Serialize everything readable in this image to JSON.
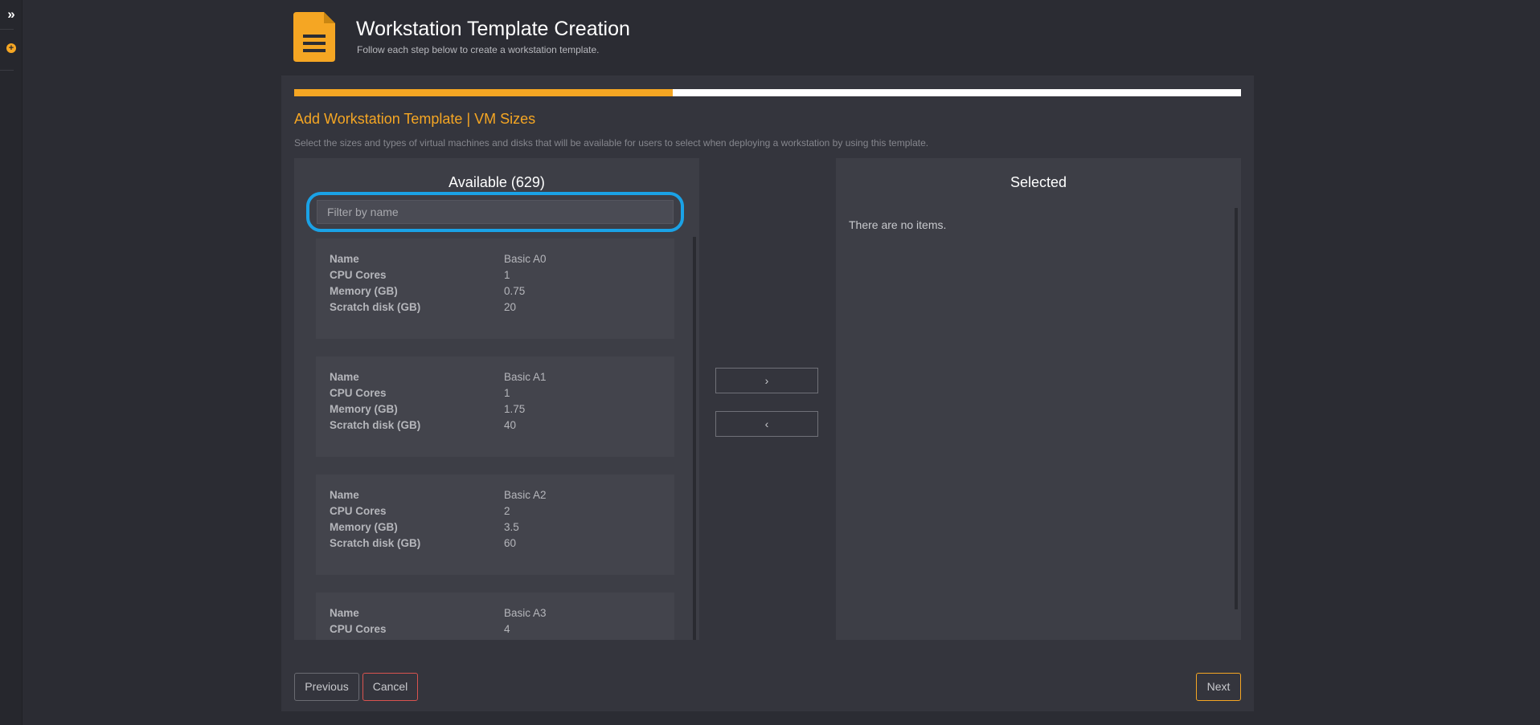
{
  "sidebar": {
    "expand_icon": "chevron-double-right-icon",
    "add_icon": "plus-circle-icon"
  },
  "header": {
    "icon": "document-icon",
    "title": "Workstation Template Creation",
    "subtitle": "Follow each step below to create a workstation template."
  },
  "progress": {
    "percent": 40
  },
  "step": {
    "title": "Add Workstation Template | VM Sizes",
    "description": "Select the sizes and types of virtual machines and disks that will be available for users to select when deploying a workstation by using this template."
  },
  "available": {
    "title": "Available (629)",
    "filter_placeholder": "Filter by name",
    "items": [
      {
        "rows": [
          {
            "key": "Name",
            "value": "Basic A0"
          },
          {
            "key": "CPU Cores",
            "value": "1"
          },
          {
            "key": "Memory (GB)",
            "value": "0.75"
          },
          {
            "key": "Scratch disk (GB)",
            "value": "20"
          }
        ]
      },
      {
        "rows": [
          {
            "key": "Name",
            "value": "Basic A1"
          },
          {
            "key": "CPU Cores",
            "value": "1"
          },
          {
            "key": "Memory (GB)",
            "value": "1.75"
          },
          {
            "key": "Scratch disk (GB)",
            "value": "40"
          }
        ]
      },
      {
        "rows": [
          {
            "key": "Name",
            "value": "Basic A2"
          },
          {
            "key": "CPU Cores",
            "value": "2"
          },
          {
            "key": "Memory (GB)",
            "value": "3.5"
          },
          {
            "key": "Scratch disk (GB)",
            "value": "60"
          }
        ]
      },
      {
        "rows": [
          {
            "key": "Name",
            "value": "Basic A3"
          },
          {
            "key": "CPU Cores",
            "value": "4"
          }
        ]
      }
    ]
  },
  "selected": {
    "title": "Selected",
    "empty_message": "There are no items."
  },
  "transfer": {
    "add_label": "›",
    "remove_label": "‹"
  },
  "footer": {
    "previous_label": "Previous",
    "cancel_label": "Cancel",
    "next_label": "Next"
  },
  "colors": {
    "accent": "#f5a623",
    "highlight": "#1aa2e6",
    "danger": "#d9534f",
    "background": "#2b2c33"
  }
}
